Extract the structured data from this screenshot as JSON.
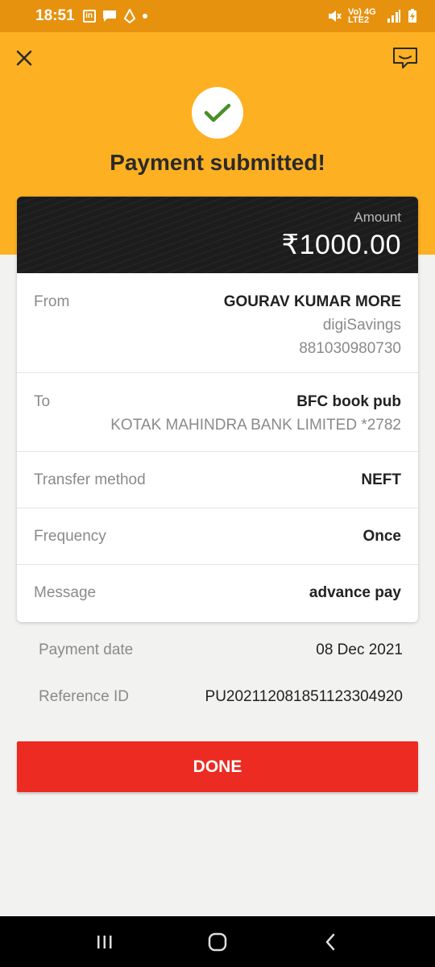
{
  "status_bar": {
    "time": "18:51",
    "notif_icons": [
      "linkedin-icon",
      "chat-bubble-icon",
      "app-icon",
      "dot-icon"
    ],
    "network_label": "Vo) 4G LTE2"
  },
  "header": {
    "title": "Payment submitted!",
    "accent_color": "#fdb022"
  },
  "amount": {
    "label": "Amount",
    "value": "₹1000.00"
  },
  "details": {
    "from": {
      "label": "From",
      "name": "GOURAV KUMAR MORE",
      "account_type": "digiSavings",
      "account_number": "881030980730"
    },
    "to": {
      "label": "To",
      "name": "BFC book pub",
      "bank": "KOTAK MAHINDRA BANK LIMITED *2782"
    },
    "transfer_method": {
      "label": "Transfer method",
      "value": "NEFT"
    },
    "frequency": {
      "label": "Frequency",
      "value": "Once"
    },
    "message": {
      "label": "Message",
      "value": "advance pay"
    }
  },
  "extra": {
    "payment_date": {
      "label": "Payment date",
      "value": "08 Dec 2021"
    },
    "reference_id": {
      "label": "Reference ID",
      "value": "PU20211208185112330492​0"
    }
  },
  "done_button": {
    "label": "DONE",
    "color": "#ec2b22"
  }
}
